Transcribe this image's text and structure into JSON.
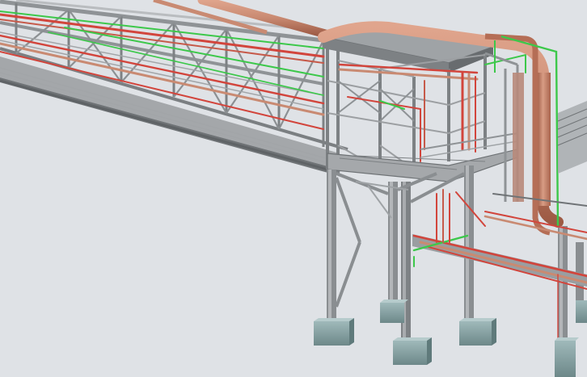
{
  "viewport": {
    "background": "#dfe2e6",
    "steel_color": "#8f9396",
    "steel_light": "#b9bcbf",
    "steel_dark": "#5f6366",
    "pipe_color": "#c98a72",
    "pipe_dark": "#a8644d",
    "pipe_red": "#d2453c",
    "cable_green": "#3cc84a",
    "foundation_color": "#88a3a4",
    "foundation_dark": "#5f7a7b"
  },
  "scene": {
    "subject": "pipe-rack-3d-model",
    "icons": [
      "pipe-rack-icon"
    ]
  }
}
